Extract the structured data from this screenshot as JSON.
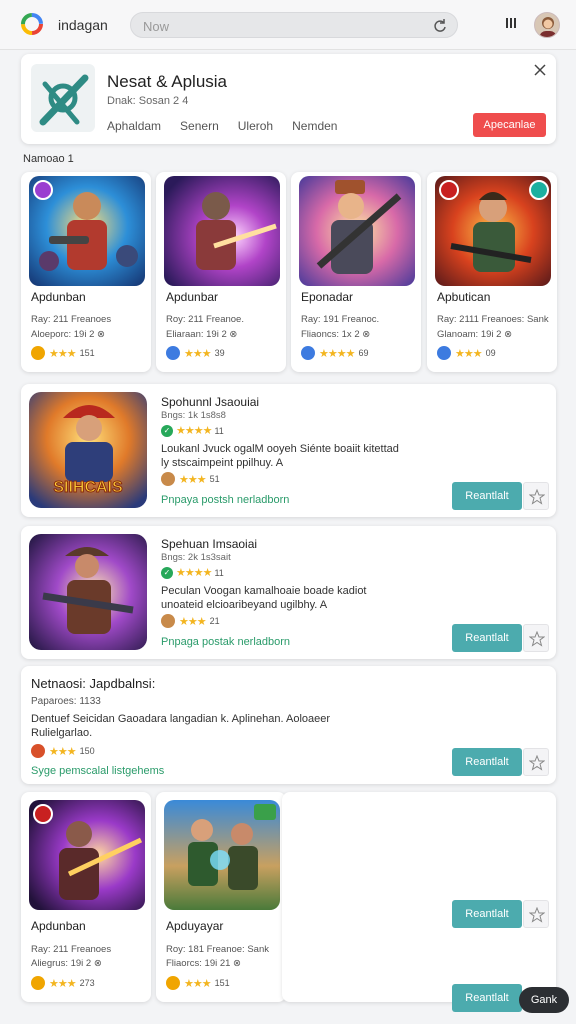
{
  "topbar": {
    "app_name": "indagan",
    "search_placeholder": "Now",
    "icons": [
      "google-icon",
      "reload-icon",
      "menu-icon",
      "avatar"
    ]
  },
  "header": {
    "title": "Nesat & Aplusia",
    "subtitle": "Dnak: Sosan 2 4",
    "tabs": [
      "Aphaldam",
      "Senern",
      "Uleroh",
      "Nemden"
    ],
    "action_label": "Apecanlae",
    "action_color": "#ef4d4d"
  },
  "section_label": "Namoao 1",
  "top_apps": [
    {
      "name": "Apdunban",
      "meta1": "Ray: 211 Freanoes",
      "meta2": "Aloeporc: 19i 2 ⊗",
      "rating": "151",
      "badge_color": "#f0a500"
    },
    {
      "name": "Apdunbar",
      "meta1": "Roy: 211 Freanoe.",
      "meta2": "Eliaraan: 19i 2 ⊗",
      "rating": "39",
      "badge_color": "#3d7be0"
    },
    {
      "name": "Eponadar",
      "meta1": "Ray: 191 Freanoc.",
      "meta2": "Fliaoncs: 1x 2 ⊗",
      "rating": "69",
      "badge_color": "#3d7be0"
    },
    {
      "name": "Apbutican",
      "meta1": "Ray: 2111 Freanoes: Sank",
      "meta2": "Glanoam: 19i 2 ⊗",
      "rating": "09",
      "badge_color": "#3d7be0"
    }
  ],
  "list_rows": [
    {
      "title": "Spohunnl Jsaouiai",
      "sub": "Bngs: 1k 1s8s8",
      "rate_count": "11",
      "desc": "Loukanl Jvuck ogalM ooyeh Siénte boaiit kitettad ly stscaimpeint ppilhuy. A",
      "rate2_count": "51",
      "link": "Pnpaya postsh nerladborn",
      "button": "Reantlalt"
    },
    {
      "title": "Spehuan Imsaoiai",
      "sub": "Bngs: 2k 1s3sait",
      "rate_count": "11",
      "desc": "Peculan Voogan kamalhoaie boade kadiot unoateid elcioaribeyand ugilbhy. A",
      "rate2_count": "21",
      "link": "Pnpaga postak nerladborn",
      "button": "Reantlalt"
    }
  ],
  "notice": {
    "title": "Netnaosi: Japdbalnsi:",
    "sub": "Paparoes: 1133",
    "desc": "Dentuef Seicidan Gaoadara langadian k. Aplinehan. Aoloaeer Rulielgarlao.",
    "rate_count": "150",
    "link": "Syge pemscalal listgehems",
    "button": "Reantlalt"
  },
  "bottom_apps": [
    {
      "name": "Apdunban",
      "meta1": "Ray: 211 Freanoes",
      "meta2": "Aliegrus: 19i 2 ⊗",
      "rating": "273",
      "badge_color": "#f0a500"
    },
    {
      "name": "Apduyayar",
      "meta1": "Roy: 181 Freanoe: Sank",
      "meta2": "Fliaorcs: 19i 21 ⊗",
      "rating": "151",
      "badge_color": "#f0a500"
    }
  ],
  "bottom_right": {
    "button1": "Reantlalt",
    "button2": "Reantlalt"
  },
  "floating": {
    "label": "Gank"
  },
  "colors": {
    "accent_teal": "#4cabae",
    "star": "#f3b520",
    "link_green": "#2a9b6a"
  }
}
